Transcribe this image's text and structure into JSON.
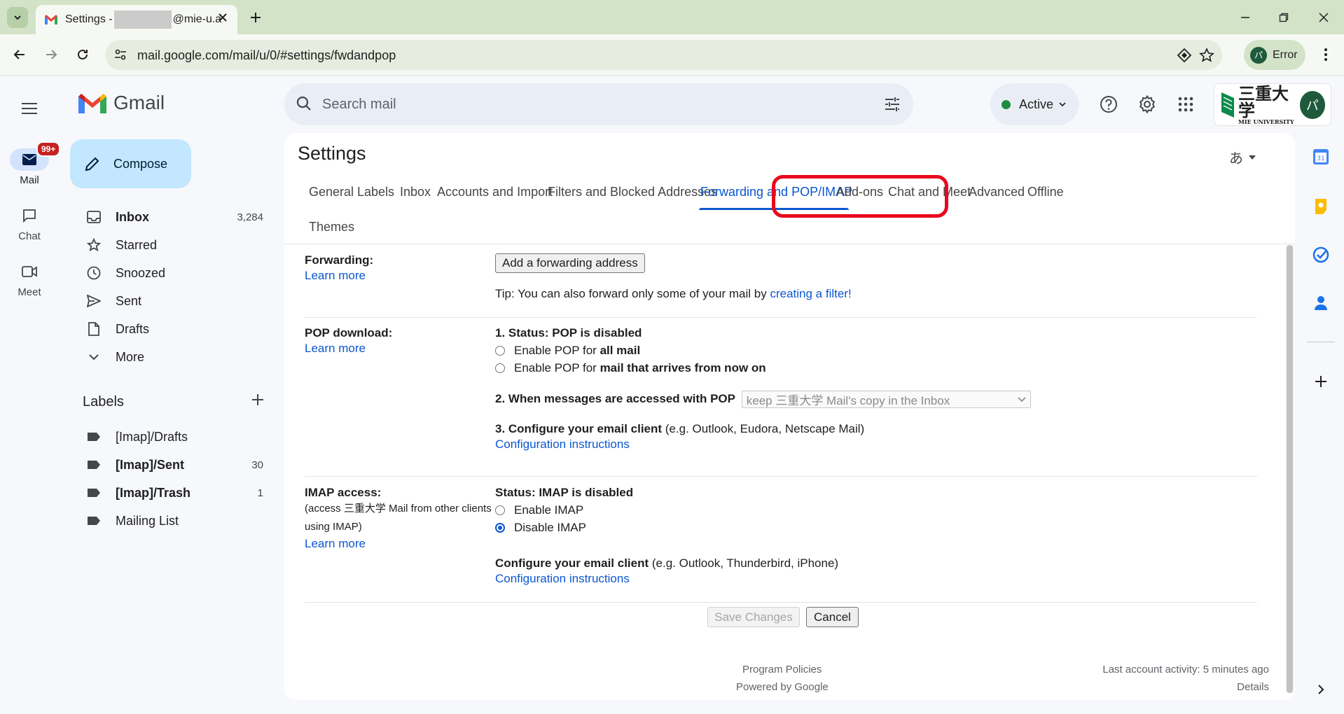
{
  "browser": {
    "tab_title_prefix": "Settings -",
    "tab_title_suffix": "@mie-u.a",
    "url": "mail.google.com/mail/u/0/#settings/fwdandpop",
    "profile_initial": "パ",
    "profile_status": "Error"
  },
  "rail": {
    "mail_label": "Mail",
    "mail_badge": "99+",
    "chat_label": "Chat",
    "meet_label": "Meet"
  },
  "sidebar": {
    "logo_text": "Gmail",
    "compose_label": "Compose",
    "nav": [
      {
        "label": "Inbox",
        "count": "3,284",
        "icon": "inbox-icon"
      },
      {
        "label": "Starred",
        "count": "",
        "icon": "star-icon"
      },
      {
        "label": "Snoozed",
        "count": "",
        "icon": "clock-icon"
      },
      {
        "label": "Sent",
        "count": "",
        "icon": "send-icon"
      },
      {
        "label": "Drafts",
        "count": "",
        "icon": "draft-icon"
      },
      {
        "label": "More",
        "count": "",
        "icon": "chevron-down-icon"
      }
    ],
    "labels_heading": "Labels",
    "labels": [
      {
        "label": "[Imap]/Drafts",
        "count": ""
      },
      {
        "label": "[Imap]/Sent",
        "count": "30"
      },
      {
        "label": "[Imap]/Trash",
        "count": "1"
      },
      {
        "label": "Mailing List",
        "count": ""
      }
    ]
  },
  "topbar": {
    "search_placeholder": "Search mail",
    "status": "Active",
    "org_main": "三重大学",
    "org_sub": "MIE UNIVERSITY",
    "avatar_initial": "パ"
  },
  "settings": {
    "title": "Settings",
    "lang_glyph": "あ",
    "tabs": [
      "General",
      "Labels",
      "Inbox",
      "Accounts and Import",
      "Filters and Blocked Addresses",
      "Forwarding and POP/IMAP",
      "Add-ons",
      "Chat and Meet",
      "Advanced",
      "Offline",
      "Themes"
    ],
    "active_tab": "Forwarding and POP/IMAP",
    "forwarding": {
      "label": "Forwarding:",
      "learn_more": "Learn more",
      "add_button": "Add a forwarding address",
      "tip_text": "Tip: You can also forward only some of your mail by",
      "tip_link": "creating a filter!"
    },
    "pop": {
      "label": "POP download:",
      "learn_more": "Learn more",
      "status": "1. Status: POP is disabled",
      "option1_prefix": "Enable POP for",
      "option1_bold": "all mail",
      "option2_prefix": "Enable POP for",
      "option2_bold": "mail that arrives from now on",
      "accessed_label": "2. When messages are accessed with POP",
      "accessed_value": "keep 三重大学 Mail's copy in the Inbox",
      "configure_bold": "3. Configure your email client",
      "configure_rest": "(e.g. Outlook, Eudora, Netscape Mail)",
      "config_link": "Configuration instructions"
    },
    "imap": {
      "label": "IMAP access:",
      "sub": "(access 三重大学 Mail from other clients using IMAP)",
      "learn_more": "Learn more",
      "status": "Status: IMAP is disabled",
      "enable": "Enable IMAP",
      "disable": "Disable IMAP",
      "configure_bold": "Configure your email client",
      "configure_rest": "(e.g. Outlook, Thunderbird, iPhone)",
      "config_link": "Configuration instructions"
    },
    "save_label": "Save Changes",
    "cancel_label": "Cancel",
    "footer": {
      "program_policies": "Program Policies",
      "powered_by": "Powered by Google",
      "last_activity": "Last account activity: 5 minutes ago",
      "details": "Details"
    }
  },
  "colors": {
    "accent": "#0b57d0",
    "highlight": "#e8091e",
    "compose_bg": "#c2e7ff",
    "chrome_bg": "#d3e3c8"
  }
}
